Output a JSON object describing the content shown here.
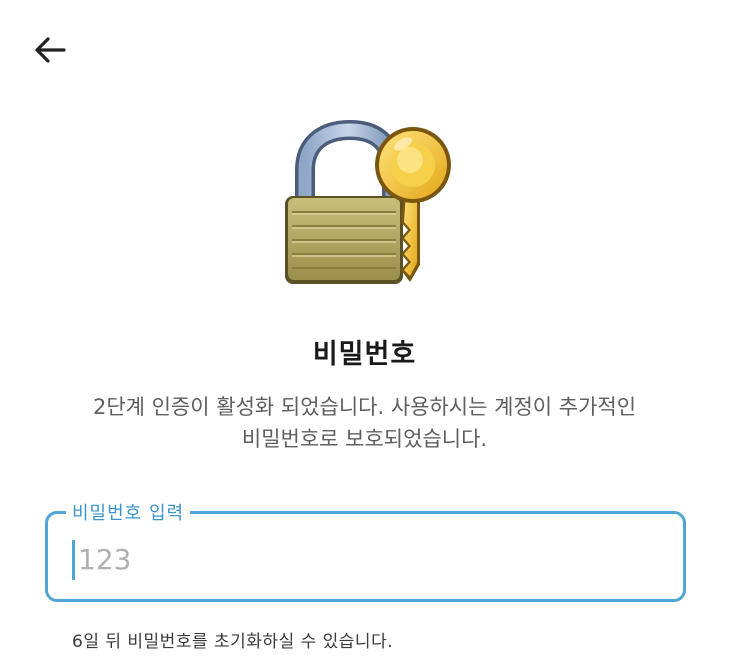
{
  "header": {
    "back_icon": "arrow-left-icon"
  },
  "hero": {
    "icon": "lock-with-key-icon"
  },
  "title": "비밀번호",
  "description": {
    "line1": "2단계 인증이 활성화 되었습니다. 사용하시는 계정이 추가적인",
    "line2": "비밀번호로 보호되었습니다."
  },
  "password_field": {
    "label": "비밀번호 입력",
    "placeholder": "123",
    "value": ""
  },
  "helper_text": "6일 뒤 비밀번호를 초기화하실 수 있습니다.",
  "colors": {
    "accent": "#4ea5d6",
    "label": "#3c95c9",
    "text": "#1a1a1a",
    "muted": "#5f5f5f"
  }
}
